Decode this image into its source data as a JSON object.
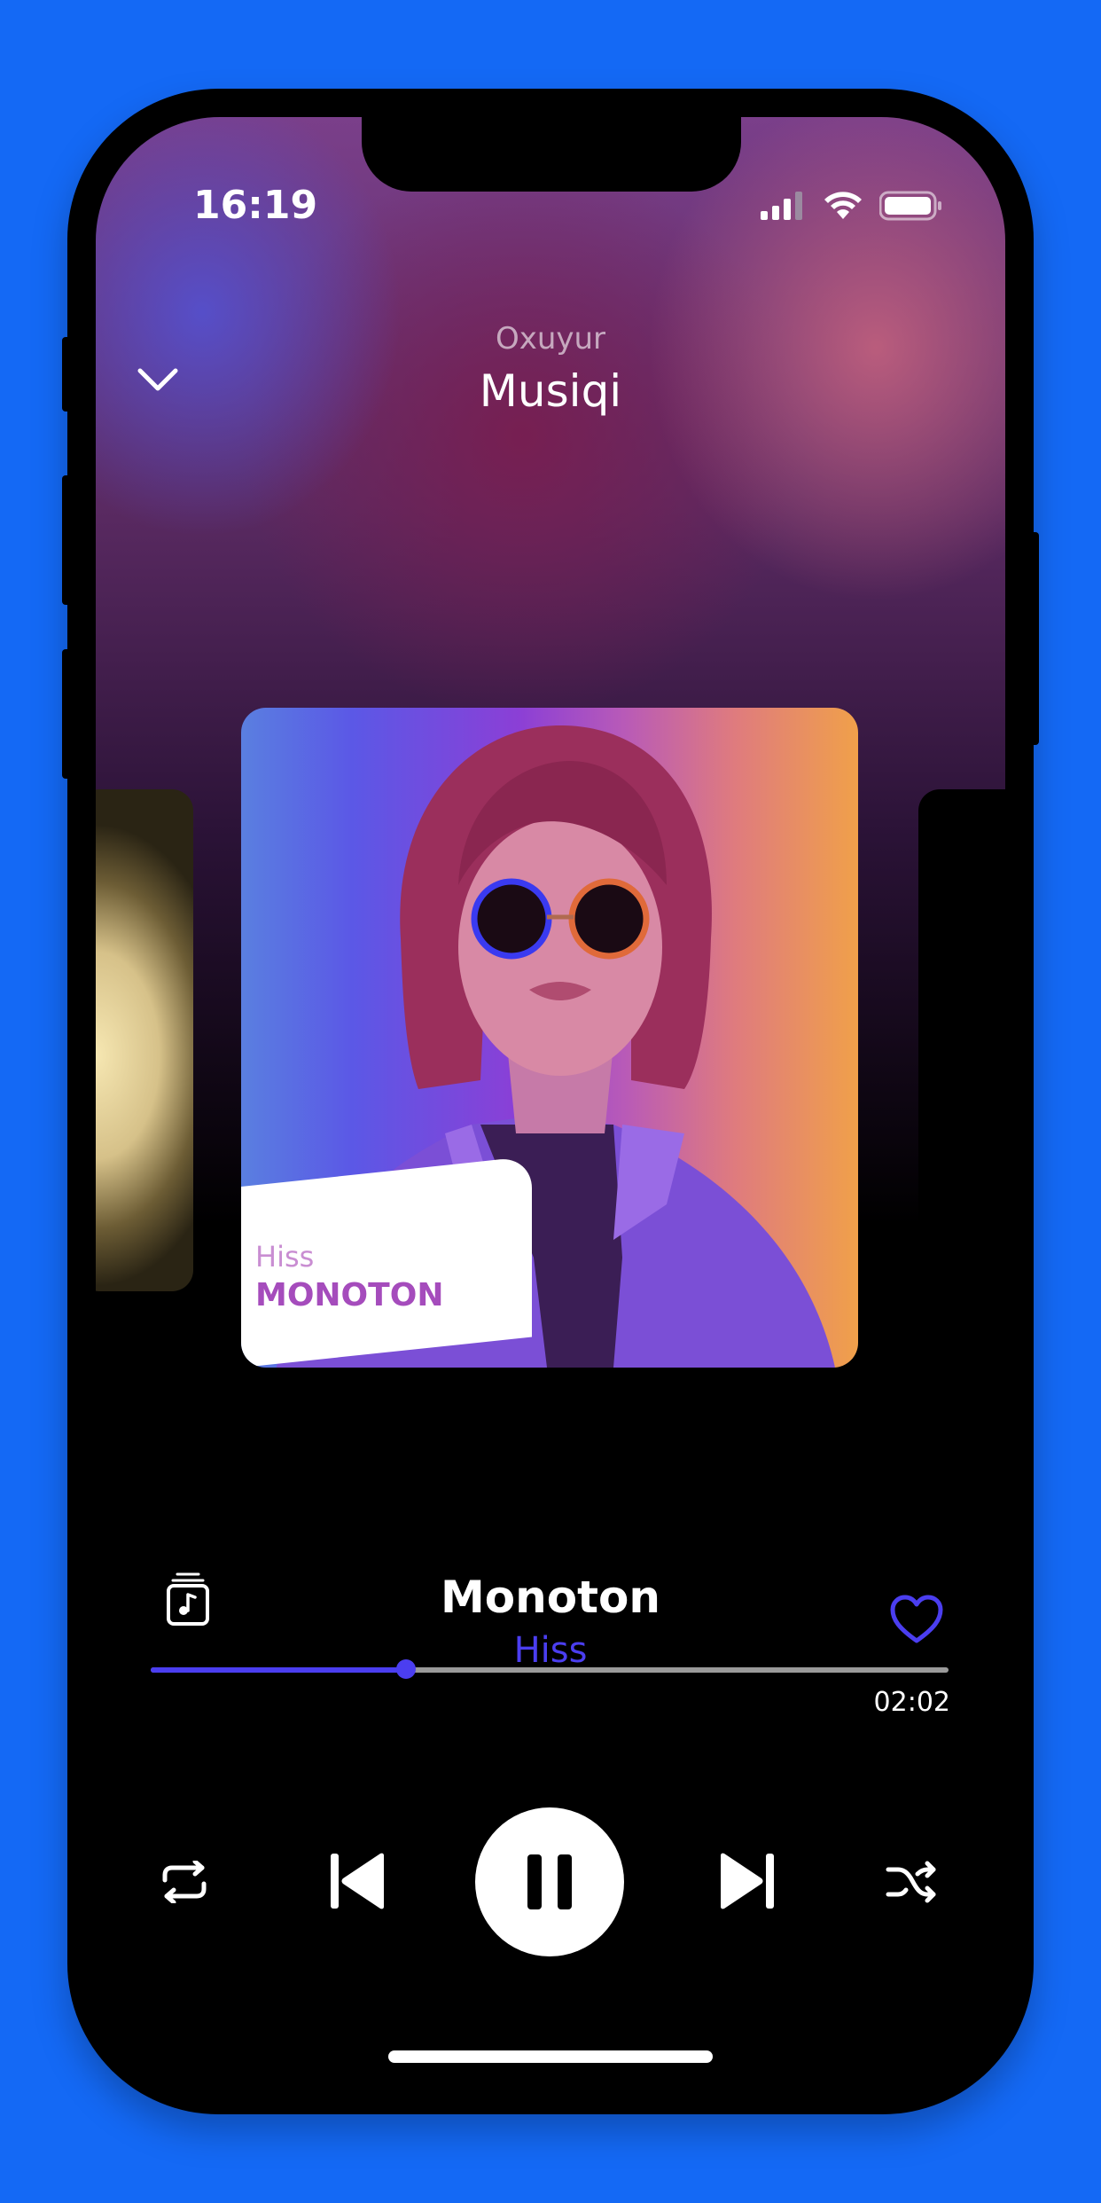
{
  "status_bar": {
    "time": "16:19"
  },
  "header": {
    "subtitle": "Oxuyur",
    "title": "Musiqi"
  },
  "album_art": {
    "label_artist": "Hiss",
    "label_title": "MONOTON"
  },
  "track": {
    "title": "Monoton",
    "artist": "Hiss",
    "liked": true
  },
  "playback": {
    "progress_fraction": 0.32,
    "time_display": "02:02",
    "state": "playing"
  },
  "colors": {
    "accent": "#4B3EF0",
    "background": "#1469F5"
  },
  "icons": {
    "collapse": "chevron-down-icon",
    "queue": "music-queue-icon",
    "like": "heart-icon",
    "repeat": "repeat-icon",
    "previous": "skip-previous-icon",
    "pause": "pause-icon",
    "next": "skip-next-icon",
    "shuffle": "shuffle-icon"
  }
}
